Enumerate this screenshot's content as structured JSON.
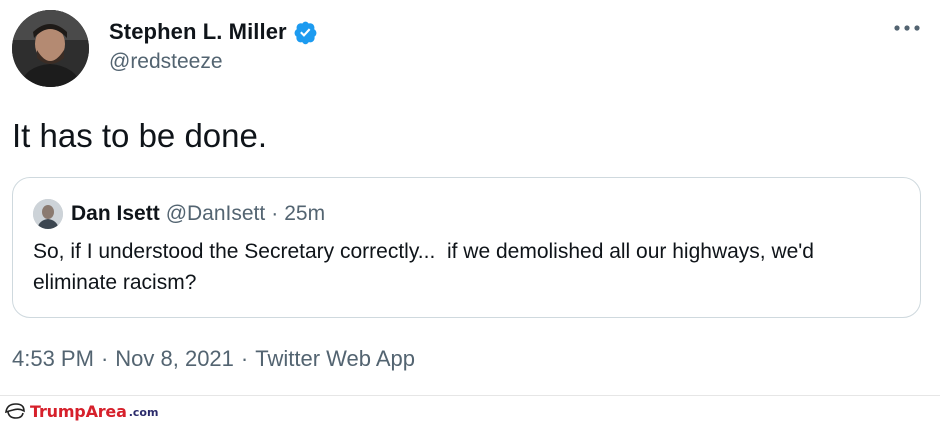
{
  "tweet": {
    "author": {
      "display_name": "Stephen L. Miller",
      "handle": "@redsteeze",
      "verified": true
    },
    "text": "It has to be done.",
    "quoted_tweet": {
      "display_name": "Dan Isett",
      "handle": "@DanIsett",
      "separator": "·",
      "time_ago": "25m",
      "text": "So, if I understood the Secretary correctly...  if we demolished all our highways, we'd eliminate racism?"
    },
    "meta": {
      "time": "4:53 PM",
      "date": "Nov 8, 2021",
      "source": "Twitter Web App",
      "separator": "·"
    }
  },
  "watermark": {
    "brand": "TrumpArea",
    "tld": ".com"
  },
  "colors": {
    "text_primary": "#0f1419",
    "text_secondary": "#536471",
    "verified_blue": "#1d9bf0",
    "border": "#cfd9de",
    "watermark_red": "#d6202b"
  },
  "icons": {
    "verified": "verified-badge-icon",
    "more": "more-options-icon"
  }
}
